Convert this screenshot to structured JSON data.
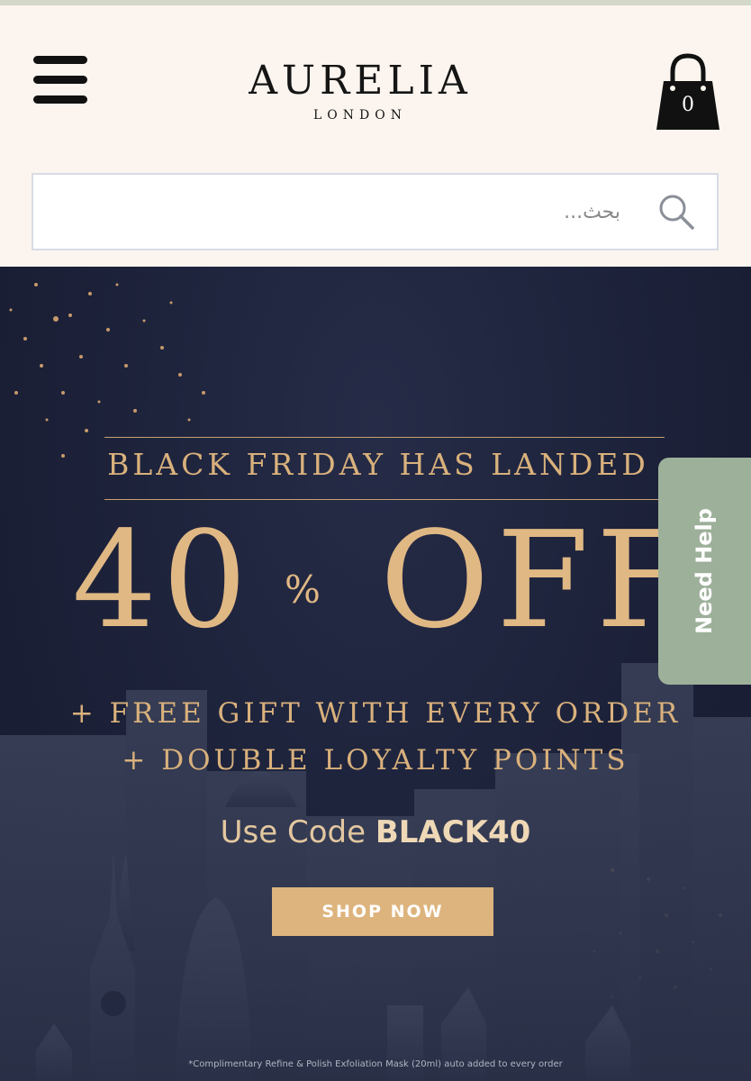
{
  "header": {
    "brand_name": "AURELIA",
    "brand_subtitle": "LONDON",
    "cart_count": "0"
  },
  "search": {
    "placeholder": "بحث..."
  },
  "banner": {
    "headline": "BLACK FRIDAY HAS LANDED",
    "discount_number": "40",
    "discount_percent": "%",
    "discount_word": "OFF",
    "perk_1": "+ FREE GIFT WITH EVERY ORDER",
    "perk_2": "+ DOUBLE LOYALTY POINTS",
    "code_prefix": "Use Code",
    "code": "BLACK40",
    "cta_label": "SHOP NOW",
    "footnote": "*Complimentary Refine & Polish Exfoliation Mask (20ml) auto added to every order"
  },
  "help_tab": {
    "label": "Need Help"
  },
  "colors": {
    "header_bg": "#fcf5ef",
    "banner_bg": "#1c2139",
    "gold": "#d9b17c",
    "button_gold": "#ddb47d",
    "help_green": "#9db09a"
  }
}
